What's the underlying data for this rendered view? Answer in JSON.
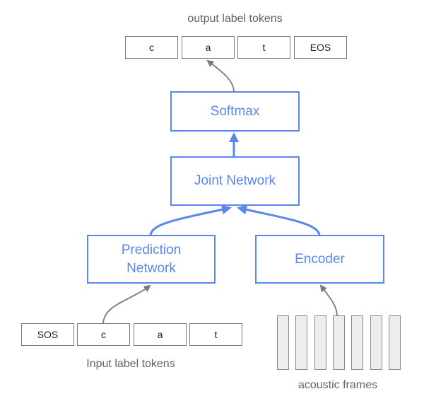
{
  "output_tokens": {
    "caption": "output label tokens",
    "items": [
      "c",
      "a",
      "t",
      "EOS"
    ]
  },
  "blocks": {
    "softmax": "Softmax",
    "joint_network": "Joint Network",
    "prediction_network": "Prediction\nNetwork",
    "encoder": "Encoder"
  },
  "input_tokens": {
    "caption": "Input label tokens",
    "items": [
      "SOS",
      "c",
      "a",
      "t"
    ]
  },
  "acoustic_frames": {
    "caption": "acoustic frames",
    "count": 7
  },
  "colors": {
    "block_accent": "#5b86ee",
    "token_border": "#7a7a7a",
    "frame_fill": "#ededed",
    "arrow_gray": "#7a7a7a"
  }
}
